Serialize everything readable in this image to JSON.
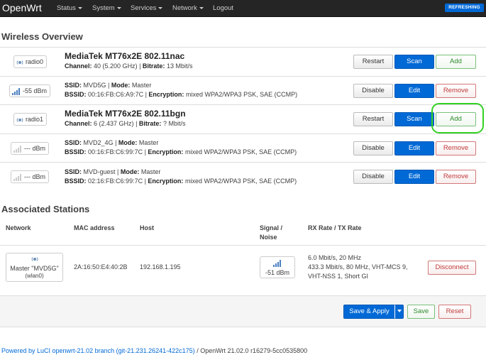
{
  "navbar": {
    "brand": "OpenWrt",
    "menus": [
      "Status",
      "System",
      "Services",
      "Network"
    ],
    "logout": "Logout",
    "badge": "REFRESHING"
  },
  "wireless": {
    "heading": "Wireless Overview",
    "radios": [
      {
        "chip": "radio0",
        "name": "MediaTek MT76x2E 802.11nac",
        "channel_label": "Channel:",
        "channel": "40 (5.200 GHz)",
        "bitrate_label": "Bitrate:",
        "bitrate": "13 Mbit/s",
        "buttons": [
          "Restart",
          "Scan",
          "Add"
        ]
      },
      {
        "chip": "radio1",
        "name": "MediaTek MT76x2E 802.11bgn",
        "channel_label": "Channel:",
        "channel": "6 (2.437 GHz)",
        "bitrate_label": "Bitrate:",
        "bitrate": "? Mbit/s",
        "buttons": [
          "Restart",
          "Scan",
          "Add"
        ]
      }
    ],
    "networks": [
      {
        "signal": "-55 dBm",
        "ssid_label": "SSID:",
        "ssid": "MVD5G",
        "mode_label": "Mode:",
        "mode": "Master",
        "bssid_label": "BSSID:",
        "bssid": "00:16:FB:C6:A9:7C",
        "enc_label": "Encryption:",
        "encryption": "mixed WPA2/WPA3 PSK, SAE (CCMP)",
        "buttons": [
          "Disable",
          "Edit",
          "Remove"
        ]
      },
      {
        "signal": "--- dBm",
        "ssid_label": "SSID:",
        "ssid": "MVD2_4G",
        "mode_label": "Mode:",
        "mode": "Master",
        "bssid_label": "BSSID:",
        "bssid": "00:16:FB:C6:99:7C",
        "enc_label": "Encryption:",
        "encryption": "mixed WPA2/WPA3 PSK, SAE (CCMP)",
        "buttons": [
          "Disable",
          "Edit",
          "Remove"
        ]
      },
      {
        "signal": "--- dBm",
        "ssid_label": "SSID:",
        "ssid": "MVD-guest",
        "mode_label": "Mode:",
        "mode": "Master",
        "bssid_label": "BSSID:",
        "bssid": "02:16:FB:C6:99:7C",
        "enc_label": "Encryption:",
        "encryption": "mixed WPA2/WPA3 PSK, SAE (CCMP)",
        "buttons": [
          "Disable",
          "Edit",
          "Remove"
        ]
      }
    ]
  },
  "stations": {
    "heading": "Associated Stations",
    "columns": [
      "Network",
      "MAC address",
      "Host",
      "Signal /",
      "Noise",
      "RX Rate / TX Rate"
    ],
    "row": {
      "network_line1": "Master \"MVD5G\"",
      "network_line2": "(wlan0)",
      "mac": "2A:16:50:E4:40:2B",
      "host": "192.168.1.195",
      "signal": "-51 dBm",
      "rate_line1": "6.0 Mbit/s, 20 MHz",
      "rate_line2": "433.3 Mbit/s, 80 MHz, VHT-MCS 9,",
      "rate_line3": "VHT-NSS 1, Short GI",
      "action": "Disconnect"
    }
  },
  "actions": {
    "save_apply": "Save & Apply",
    "save": "Save",
    "reset": "Reset"
  },
  "footer": {
    "link": "Powered by LuCI openwrt-21.02 branch (git-21.231.26241-422c175)",
    "text": " / OpenWrt 21.02.0 r16279-5cc0535800"
  },
  "colors": {
    "navbar": "#252525",
    "primary": "#0069d6",
    "positive": "#2c8a2c",
    "negative": "#c23a3a",
    "highlight": "#34d024"
  }
}
